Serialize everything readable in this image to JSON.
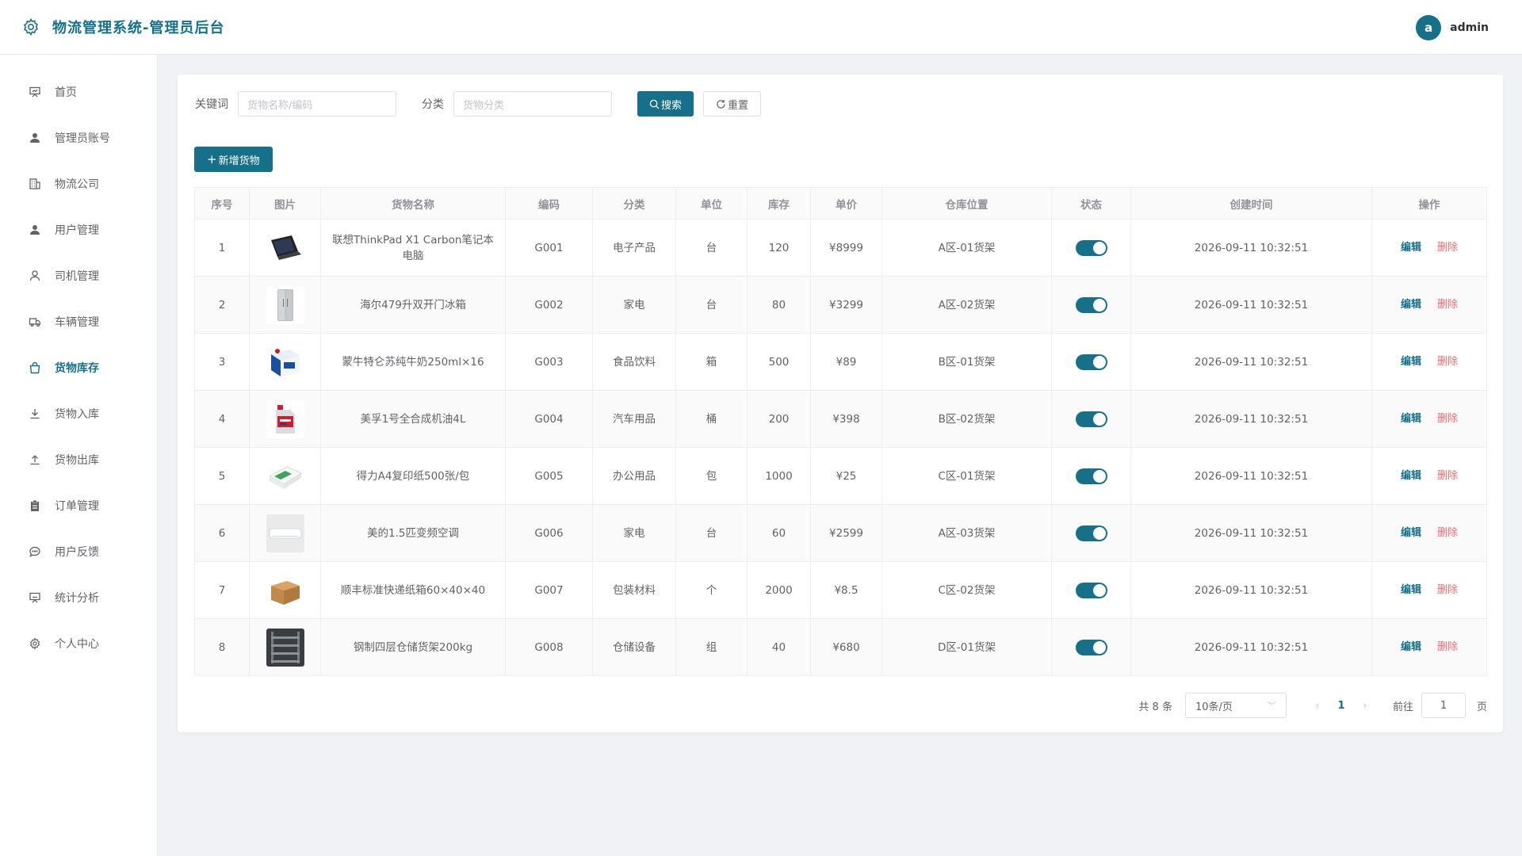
{
  "header": {
    "title": "物流管理系统-管理员后台",
    "avatar_letter": "a",
    "username": "admin"
  },
  "sidebar": {
    "items": [
      {
        "label": "首页",
        "icon": "dashboard-icon",
        "active": false
      },
      {
        "label": "管理员账号",
        "icon": "user-icon",
        "active": false
      },
      {
        "label": "物流公司",
        "icon": "building-icon",
        "active": false
      },
      {
        "label": "用户管理",
        "icon": "user-icon",
        "active": false
      },
      {
        "label": "司机管理",
        "icon": "user-outline-icon",
        "active": false
      },
      {
        "label": "车辆管理",
        "icon": "truck-icon",
        "active": false
      },
      {
        "label": "货物库存",
        "icon": "bag-icon",
        "active": true
      },
      {
        "label": "货物入库",
        "icon": "download-icon",
        "active": false
      },
      {
        "label": "货物出库",
        "icon": "upload-icon",
        "active": false
      },
      {
        "label": "订单管理",
        "icon": "clipboard-icon",
        "active": false
      },
      {
        "label": "用户反馈",
        "icon": "chat-icon",
        "active": false
      },
      {
        "label": "统计分析",
        "icon": "chart-icon",
        "active": false
      },
      {
        "label": "个人中心",
        "icon": "gear-icon",
        "active": false
      }
    ]
  },
  "filter": {
    "keyword_label": "关键词",
    "keyword_placeholder": "货物名称/编码",
    "category_label": "分类",
    "category_placeholder": "货物分类",
    "search_label": "搜索",
    "reset_label": "重置"
  },
  "add_button_label": "新增货物",
  "table": {
    "headers": [
      "序号",
      "图片",
      "货物名称",
      "编码",
      "分类",
      "单位",
      "库存",
      "单价",
      "仓库位置",
      "状态",
      "创建时间",
      "操作"
    ],
    "edit_label": "编辑",
    "delete_label": "删除",
    "rows": [
      {
        "idx": "1",
        "image": "laptop",
        "name": "联想ThinkPad X1 Carbon笔记本电脑",
        "code": "G001",
        "category": "电子产品",
        "unit": "台",
        "stock": "120",
        "price": "¥8999",
        "location": "A区-01货架",
        "status": true,
        "created": "2026-09-11 10:32:51"
      },
      {
        "idx": "2",
        "image": "fridge",
        "name": "海尔479升双开门冰箱",
        "code": "G002",
        "category": "家电",
        "unit": "台",
        "stock": "80",
        "price": "¥3299",
        "location": "A区-02货架",
        "status": true,
        "created": "2026-09-11 10:32:51"
      },
      {
        "idx": "3",
        "image": "milk",
        "name": "蒙牛特仑苏纯牛奶250ml×16",
        "code": "G003",
        "category": "食品饮料",
        "unit": "箱",
        "stock": "500",
        "price": "¥89",
        "location": "B区-01货架",
        "status": true,
        "created": "2026-09-11 10:32:51"
      },
      {
        "idx": "4",
        "image": "oil",
        "name": "美孚1号全合成机油4L",
        "code": "G004",
        "category": "汽车用品",
        "unit": "桶",
        "stock": "200",
        "price": "¥398",
        "location": "B区-02货架",
        "status": true,
        "created": "2026-09-11 10:32:51"
      },
      {
        "idx": "5",
        "image": "paper",
        "name": "得力A4复印纸500张/包",
        "code": "G005",
        "category": "办公用品",
        "unit": "包",
        "stock": "1000",
        "price": "¥25",
        "location": "C区-01货架",
        "status": true,
        "created": "2026-09-11 10:32:51"
      },
      {
        "idx": "6",
        "image": "aircon",
        "name": "美的1.5匹变频空调",
        "code": "G006",
        "category": "家电",
        "unit": "台",
        "stock": "60",
        "price": "¥2599",
        "location": "A区-03货架",
        "status": true,
        "created": "2026-09-11 10:32:51"
      },
      {
        "idx": "7",
        "image": "box",
        "name": "顺丰标准快递纸箱60×40×40",
        "code": "G007",
        "category": "包装材料",
        "unit": "个",
        "stock": "2000",
        "price": "¥8.5",
        "location": "C区-02货架",
        "status": true,
        "created": "2026-09-11 10:32:51"
      },
      {
        "idx": "8",
        "image": "shelf",
        "name": "钢制四层仓储货架200kg",
        "code": "G008",
        "category": "仓储设备",
        "unit": "组",
        "stock": "40",
        "price": "¥680",
        "location": "D区-01货架",
        "status": true,
        "created": "2026-09-11 10:32:51"
      }
    ]
  },
  "pagination": {
    "total_text": "共 8 条",
    "page_size": "10条/页",
    "current_page": "1",
    "goto_label": "前往",
    "goto_value": "1",
    "page_suffix": "页"
  },
  "colors": {
    "primary": "#17708a",
    "danger": "#f56c6c",
    "background": "#f0f2f5"
  }
}
